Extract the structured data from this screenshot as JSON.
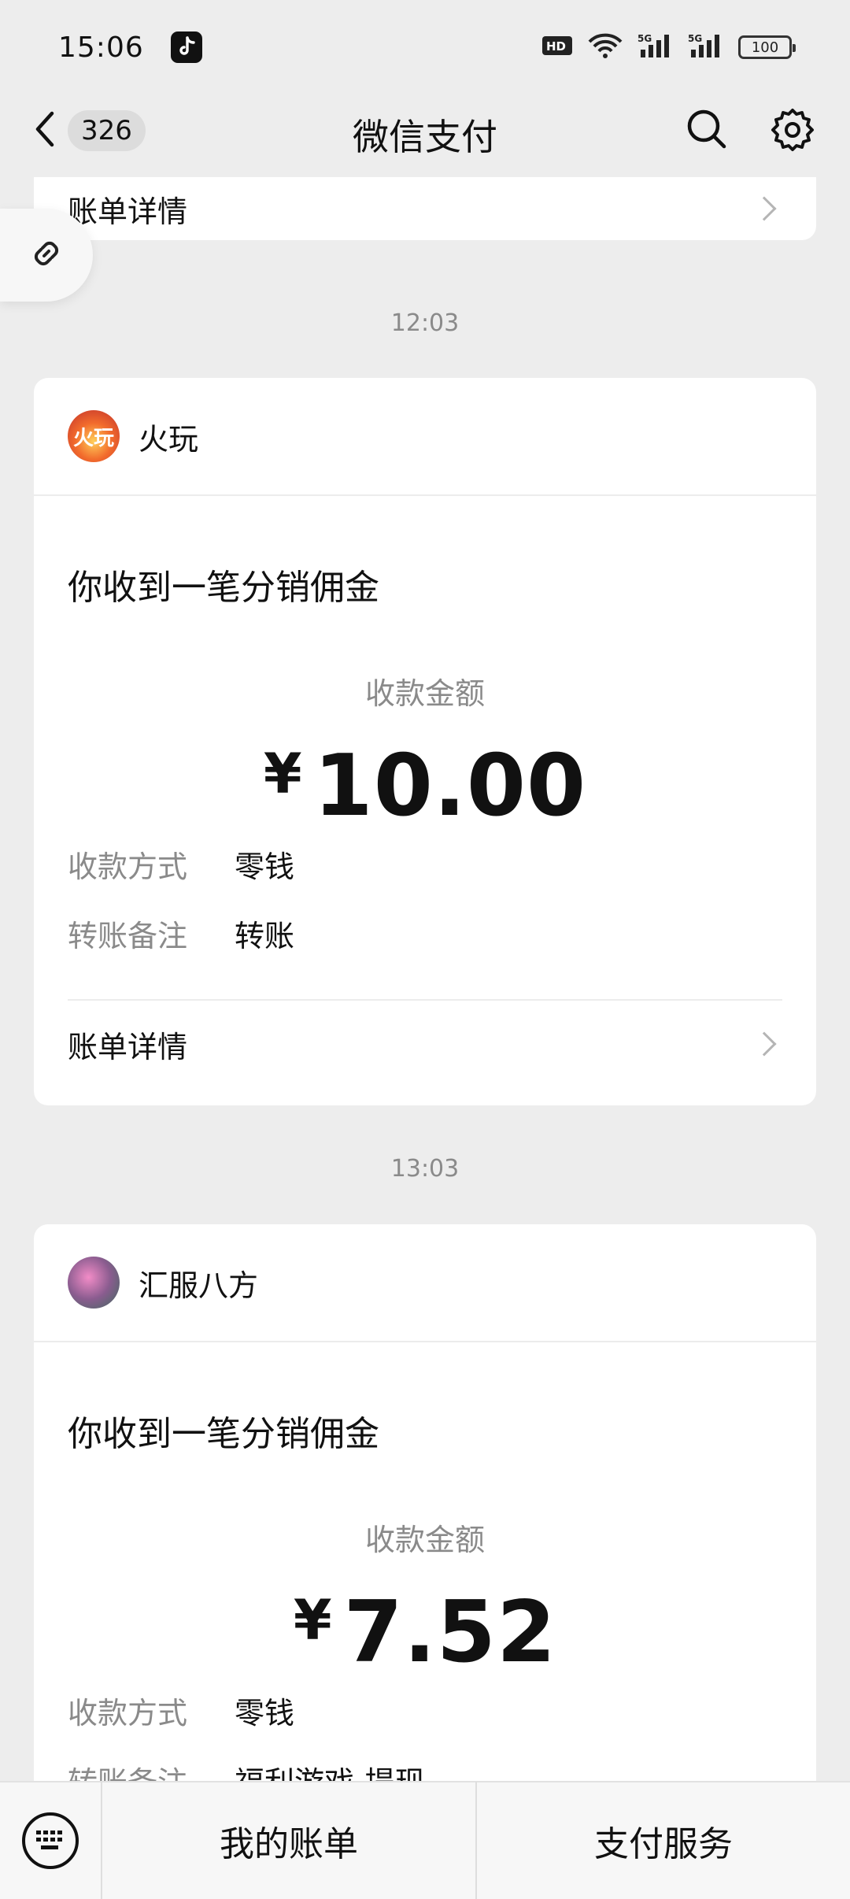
{
  "status_bar": {
    "time": "15:06",
    "app_icon": "tiktok-icon",
    "battery": "100",
    "signal_labels": [
      "HD",
      "5G",
      "5G"
    ]
  },
  "nav": {
    "back_count": "326",
    "title": "微信支付",
    "icons": [
      "search-icon",
      "gear-icon"
    ]
  },
  "prev_card": {
    "detail_label": "账单详情"
  },
  "messages": [
    {
      "time": "12:03",
      "merchant": "火玩",
      "avatar_text": "火玩",
      "headline": "你收到一笔分销佣金",
      "amount_label": "收款金额",
      "currency": "¥",
      "amount": "10.00",
      "method_key": "收款方式",
      "method_value": "零钱",
      "note_key": "转账备注",
      "note_value": "转账",
      "detail_label": "账单详情"
    },
    {
      "time": "13:03",
      "merchant": "汇服八方",
      "avatar_text": "",
      "headline": "你收到一笔分销佣金",
      "amount_label": "收款金额",
      "currency": "¥",
      "amount": "7.52",
      "method_key": "收款方式",
      "method_value": "零钱",
      "note_key": "转账备注",
      "note_value": "福利游戏-提现"
    }
  ],
  "bottom_bar": {
    "items": [
      "我的账单",
      "支付服务"
    ]
  },
  "colors": {
    "background": "#ededed",
    "card": "#ffffff",
    "muted_text": "#8a8a8a"
  }
}
